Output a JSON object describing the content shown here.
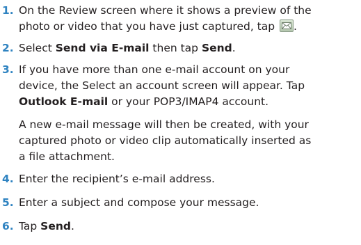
{
  "steps": [
    {
      "number": "1.",
      "line1": "On the Review screen where it shows a preview of the",
      "line2_pre": "photo or video that you have just captured, tap",
      "line2_post": ".",
      "icon": "email-envelope-icon"
    },
    {
      "number": "2.",
      "pre": "Select ",
      "b1": "Send via E-mail",
      "mid": " then tap ",
      "b2": "Send",
      "post": "."
    },
    {
      "number": "3.",
      "line1": "If you have more than one e-mail account on your",
      "line2": "device, the Select an account screen will appear. Tap",
      "line3_b": "Outlook E-mail",
      "line3_post": " or your POP3/IMAP4 account."
    },
    {
      "note_line1": "A new e-mail message will then be created, with your",
      "note_line2": "captured photo or video clip automatically inserted as",
      "note_line3": "a file attachment."
    },
    {
      "number": "4.",
      "text": "Enter the recipient’s e-mail address."
    },
    {
      "number": "5.",
      "text": "Enter a subject and compose your message."
    },
    {
      "number": "6.",
      "pre": "Tap ",
      "b1": "Send",
      "post": "."
    }
  ]
}
